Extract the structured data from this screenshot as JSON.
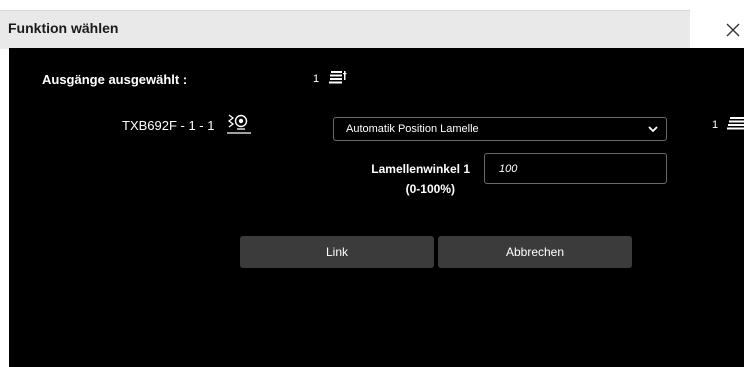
{
  "dialog": {
    "title": "Funktion wählen",
    "close_symbol": "✕"
  },
  "outputs": {
    "label": "Ausgänge ausgewählt :",
    "count": "1",
    "icon": "blind-icon"
  },
  "device": {
    "label": "TXB692F - 1 - 1",
    "icon": "sensor-icon",
    "function_select": {
      "selected": "Automatik Position Lamelle"
    },
    "right_count": "1"
  },
  "parameter": {
    "label_line1": "Lamellenwinkel 1",
    "label_line2": "(0-100%)",
    "value": "100"
  },
  "buttons": {
    "link": "Link",
    "cancel": "Abbrechen"
  },
  "colors": {
    "header_bg": "#e9e9e9",
    "body_bg": "#000000",
    "button_bg": "#3b3b3b"
  }
}
